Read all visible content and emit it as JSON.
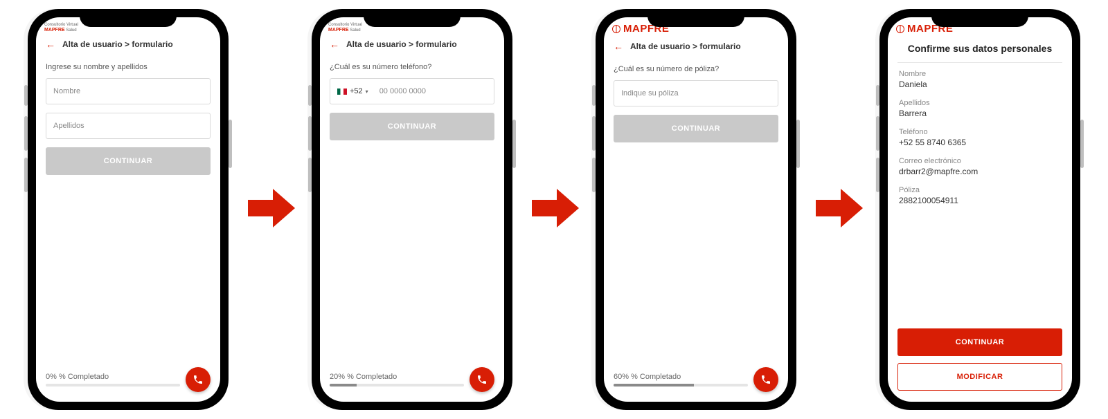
{
  "brand": {
    "consultorio_line1": "Consultorio Virtual",
    "consultorio_mapfre": "MAPFRE",
    "consultorio_salud": "Salud",
    "mapfre_big": "MAPFRE"
  },
  "common": {
    "breadcrumb": "Alta de usuario > formulario",
    "continue": "CONTINUAR",
    "modify": "MODIFICAR"
  },
  "screen1": {
    "prompt": "Ingrese su nombre y apellidos",
    "input_name_ph": "Nombre",
    "input_lastname_ph": "Apellidos",
    "progress_label": "0% % Completado",
    "progress_pct": 0
  },
  "screen2": {
    "prompt": "¿Cuál es su número teléfono?",
    "country_code": "+52",
    "phone_ph": "00 0000 0000",
    "progress_label": "20% % Completado",
    "progress_pct": 20
  },
  "screen3": {
    "prompt": "¿Cuál es su número de póliza?",
    "policy_ph": "Indique su póliza",
    "progress_label": "60% % Completado",
    "progress_pct": 60
  },
  "screen4": {
    "title": "Confirme sus datos personales",
    "name_label": "Nombre",
    "name_value": "Daniela",
    "lastname_label": "Apellidos",
    "lastname_value": "Barrera",
    "phone_label": "Teléfono",
    "phone_value": "+52 55 8740 6365",
    "email_label": "Correo electrónico",
    "email_value": "drbarr2@mapfre.com",
    "policy_label": "Póliza",
    "policy_value": "2882100054911"
  }
}
